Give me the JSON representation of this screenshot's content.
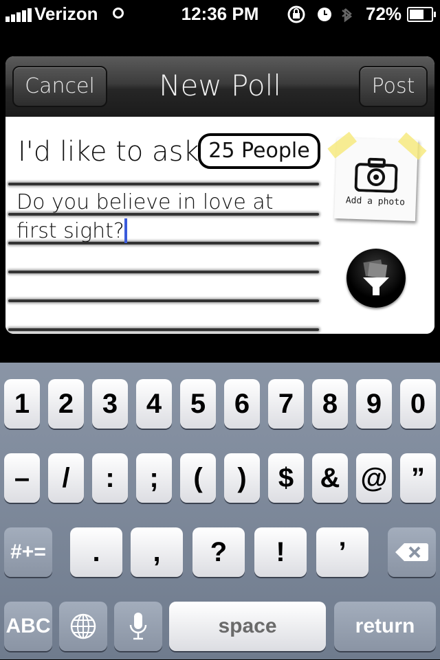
{
  "status_bar": {
    "carrier": "Verizon",
    "time": "12:36 PM",
    "battery": "72%"
  },
  "nav": {
    "cancel_label": "Cancel",
    "title": "New Poll",
    "post_label": "Post"
  },
  "form": {
    "ask_label": "I'd like to ask",
    "audience": "25 People",
    "question": "Do you believe in love at first sight?",
    "add_photo_label": "Add a photo"
  },
  "keyboard": {
    "row1": [
      "1",
      "2",
      "3",
      "4",
      "5",
      "6",
      "7",
      "8",
      "9",
      "0"
    ],
    "row2": [
      "–",
      "/",
      ":",
      ";",
      "(",
      ")",
      "$",
      "&",
      "@",
      "”"
    ],
    "row3": [
      ".",
      ",",
      "?",
      "!",
      "’"
    ],
    "shift_symbols": "#+=",
    "abc": "ABC",
    "space": "space",
    "return": "return"
  },
  "icons": [
    "signal-icon",
    "wifi-icon",
    "orientation-lock-icon",
    "alarm-icon",
    "bluetooth-icon",
    "battery-icon",
    "camera-icon",
    "filter-icon",
    "globe-icon",
    "microphone-icon",
    "backspace-icon"
  ]
}
